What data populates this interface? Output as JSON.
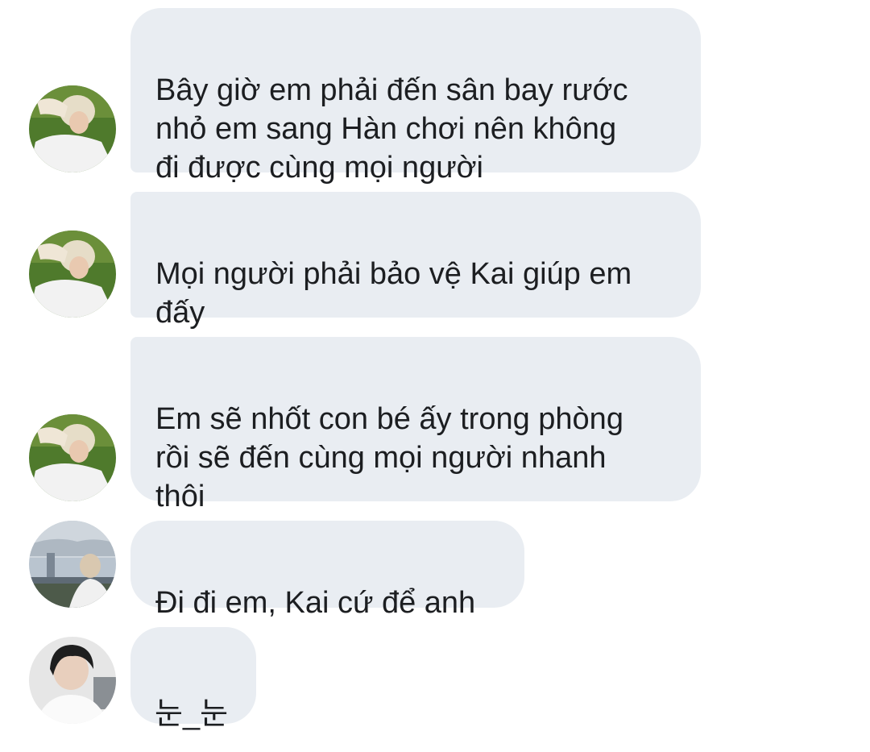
{
  "messages": [
    {
      "sender_avatar": "avatar-blond-man-green-background",
      "text": "Bây giờ em phải đến sân bay rước\nnhỏ em sang Hàn chơi nên không\nđi được cùng mọi người"
    },
    {
      "sender_avatar": "avatar-blond-man-green-background",
      "text": "Mọi người phải bảo vệ Kai giúp em\nđấy"
    },
    {
      "sender_avatar": "avatar-blond-man-green-background",
      "text": "Em sẽ nhốt con bé ấy trong phòng\nrồi sẽ đến cùng mọi người nhanh\nthôi"
    },
    {
      "sender_avatar": "avatar-man-city-bridge",
      "text": "Đi đi em, Kai cứ để anh"
    },
    {
      "sender_avatar": "avatar-dark-hair-man-white-shirt",
      "text": "눈_눈"
    }
  ],
  "colors": {
    "bubble_background": "#e9edf2",
    "message_text": "#1c1e21",
    "page_background": "#ffffff"
  }
}
